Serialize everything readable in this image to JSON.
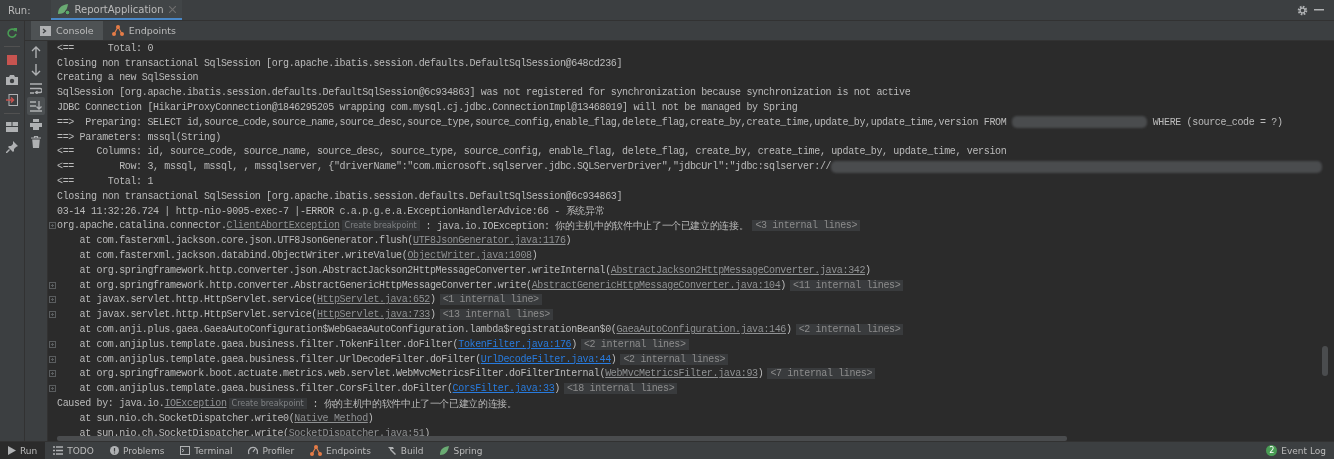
{
  "run_bar": {
    "label": "Run:",
    "tabs": [
      {
        "label": "ReportApplication",
        "selected": true
      }
    ]
  },
  "console_tabs": [
    {
      "label": "Console",
      "kind": "console",
      "selected": true
    },
    {
      "label": "Endpoints",
      "kind": "endpoints",
      "selected": false
    }
  ],
  "left_tools": [
    {
      "kind": "rerun",
      "on": false
    },
    {
      "kind": "stop",
      "on": false
    },
    {
      "kind": "camera",
      "on": false
    },
    {
      "kind": "exit",
      "on": false
    },
    {
      "kind": "layout",
      "on": false
    },
    {
      "kind": "pin",
      "on": false
    }
  ],
  "console_tools": [
    {
      "kind": "up",
      "on": false
    },
    {
      "kind": "down",
      "on": false
    },
    {
      "kind": "wrap",
      "on": false
    },
    {
      "kind": "scroll-end",
      "on": true
    },
    {
      "kind": "print",
      "on": false
    },
    {
      "kind": "trash",
      "on": false
    }
  ],
  "console_lines": [
    {
      "fold": false,
      "segments": [
        {
          "kind": "text",
          "text": "<==      Total: 0"
        }
      ]
    },
    {
      "fold": false,
      "segments": [
        {
          "kind": "text",
          "text": "Closing non transactional SqlSession [org.apache.ibatis.session.defaults.DefaultSqlSession@648cd236]"
        }
      ]
    },
    {
      "fold": false,
      "segments": [
        {
          "kind": "text",
          "text": "Creating a new SqlSession"
        }
      ]
    },
    {
      "fold": false,
      "segments": [
        {
          "kind": "text",
          "text": "SqlSession [org.apache.ibatis.session.defaults.DefaultSqlSession@6c934863] was not registered for synchronization because synchronization is not active"
        }
      ]
    },
    {
      "fold": false,
      "segments": [
        {
          "kind": "text",
          "text": "JDBC Connection [HikariProxyConnection@1846295205 wrapping com.mysql.cj.jdbc.ConnectionImpl@13468019] will not be managed by Spring"
        }
      ]
    },
    {
      "fold": false,
      "segments": [
        {
          "kind": "text",
          "text": "==>  Preparing: SELECT id,source_code,source_name,source_desc,source_type,source_config,enable_flag,delete_flag,create_by,create_time,update_by,update_time,version FROM "
        },
        {
          "kind": "redacted"
        },
        {
          "kind": "text",
          "text": " WHERE (source_code = ?)"
        }
      ]
    },
    {
      "fold": false,
      "segments": [
        {
          "kind": "text",
          "text": "==> Parameters: mssql(String)"
        }
      ]
    },
    {
      "fold": false,
      "segments": [
        {
          "kind": "text",
          "text": "<==    Columns: id, source_code, source_name, source_desc, source_type, source_config, enable_flag, delete_flag, create_by, create_time, update_by, update_time, version"
        }
      ]
    },
    {
      "fold": false,
      "segments": [
        {
          "kind": "text",
          "text": "<==        Row: 3, mssql, mssql, , mssqlserver, {\"driverName\":\"com.microsoft.sqlserver.jdbc.SQLServerDriver\",\"jdbcUrl\":\"jdbc:sqlserver://"
        },
        {
          "kind": "redacted"
        }
      ]
    },
    {
      "fold": false,
      "segments": [
        {
          "kind": "text",
          "text": "<==      Total: 1"
        }
      ]
    },
    {
      "fold": false,
      "segments": [
        {
          "kind": "text",
          "text": "Closing non transactional SqlSession [org.apache.ibatis.session.defaults.DefaultSqlSession@6c934863]"
        }
      ]
    },
    {
      "fold": false,
      "segments": [
        {
          "kind": "text",
          "text": "03-14 11:32:26.724 | http-nio-9095-exec-7 |-ERROR c.a.p.g.e.a.ExceptionHandlerAdvice:66 - 系统异常"
        }
      ]
    },
    {
      "fold": true,
      "segments": [
        {
          "kind": "text",
          "text": "org.apache.catalina.connector."
        },
        {
          "kind": "link",
          "text": "ClientAbortException"
        },
        {
          "kind": "breakpoint",
          "text": "Create breakpoint"
        },
        {
          "kind": "text",
          "text": " : java.io.IOException: 你的主机中的软件中止了一个已建立的连接。"
        },
        {
          "kind": "hint",
          "text": "<3 internal lines>"
        }
      ]
    },
    {
      "fold": false,
      "segments": [
        {
          "kind": "text",
          "text": "    at com.fasterxml.jackson.core.json.UTF8JsonGenerator.flush("
        },
        {
          "kind": "link",
          "text": "UTF8JsonGenerator.java:1176"
        },
        {
          "kind": "text",
          "text": ")"
        }
      ]
    },
    {
      "fold": false,
      "segments": [
        {
          "kind": "text",
          "text": "    at com.fasterxml.jackson.databind.ObjectWriter.writeValue("
        },
        {
          "kind": "link",
          "text": "ObjectWriter.java:1008"
        },
        {
          "kind": "text",
          "text": ")"
        }
      ]
    },
    {
      "fold": false,
      "segments": [
        {
          "kind": "text",
          "text": "    at org.springframework.http.converter.json.AbstractJackson2HttpMessageConverter.writeInternal("
        },
        {
          "kind": "link",
          "text": "AbstractJackson2HttpMessageConverter.java:342"
        },
        {
          "kind": "text",
          "text": ")"
        }
      ]
    },
    {
      "fold": true,
      "segments": [
        {
          "kind": "text",
          "text": "    at org.springframework.http.converter.AbstractGenericHttpMessageConverter.write("
        },
        {
          "kind": "link",
          "text": "AbstractGenericHttpMessageConverter.java:104"
        },
        {
          "kind": "text",
          "text": ")"
        },
        {
          "kind": "hint",
          "text": "<11 internal lines>"
        }
      ]
    },
    {
      "fold": true,
      "segments": [
        {
          "kind": "text",
          "text": "    at javax.servlet.http.HttpServlet.service("
        },
        {
          "kind": "link",
          "text": "HttpServlet.java:652"
        },
        {
          "kind": "text",
          "text": ")"
        },
        {
          "kind": "hint",
          "text": "<1 internal line>"
        }
      ]
    },
    {
      "fold": true,
      "segments": [
        {
          "kind": "text",
          "text": "    at javax.servlet.http.HttpServlet.service("
        },
        {
          "kind": "link",
          "text": "HttpServlet.java:733"
        },
        {
          "kind": "text",
          "text": ")"
        },
        {
          "kind": "hint",
          "text": "<13 internal lines>"
        }
      ]
    },
    {
      "fold": false,
      "segments": [
        {
          "kind": "text",
          "text": "    at com.anji.plus.gaea.GaeaAutoConfiguration$WebGaeaAutoConfiguration.lambda$registrationBean$0("
        },
        {
          "kind": "link",
          "text": "GaeaAutoConfiguration.java:146"
        },
        {
          "kind": "text",
          "text": ")"
        },
        {
          "kind": "hint",
          "text": "<2 internal lines>"
        }
      ]
    },
    {
      "fold": true,
      "segments": [
        {
          "kind": "text",
          "text": "    at com.anjiplus.template.gaea.business.filter.TokenFilter.doFilter("
        },
        {
          "kind": "source-link",
          "text": "TokenFilter.java:176"
        },
        {
          "kind": "text",
          "text": ")"
        },
        {
          "kind": "hint",
          "text": "<2 internal lines>"
        }
      ]
    },
    {
      "fold": true,
      "segments": [
        {
          "kind": "text",
          "text": "    at com.anjiplus.template.gaea.business.filter.UrlDecodeFilter.doFilter("
        },
        {
          "kind": "source-link",
          "text": "UrlDecodeFilter.java:44"
        },
        {
          "kind": "text",
          "text": ")"
        },
        {
          "kind": "hint",
          "text": "<2 internal lines>"
        }
      ]
    },
    {
      "fold": true,
      "segments": [
        {
          "kind": "text",
          "text": "    at org.springframework.boot.actuate.metrics.web.servlet.WebMvcMetricsFilter.doFilterInternal("
        },
        {
          "kind": "link",
          "text": "WebMvcMetricsFilter.java:93"
        },
        {
          "kind": "text",
          "text": ")"
        },
        {
          "kind": "hint",
          "text": "<7 internal lines>"
        }
      ]
    },
    {
      "fold": true,
      "segments": [
        {
          "kind": "text",
          "text": "    at com.anjiplus.template.gaea.business.filter.CorsFilter.doFilter("
        },
        {
          "kind": "source-link",
          "text": "CorsFilter.java:33"
        },
        {
          "kind": "text",
          "text": ")"
        },
        {
          "kind": "hint",
          "text": "<18 internal lines>"
        }
      ]
    },
    {
      "fold": false,
      "segments": [
        {
          "kind": "text",
          "text": "Caused by: java.io."
        },
        {
          "kind": "link",
          "text": "IOException"
        },
        {
          "kind": "breakpoint",
          "text": "Create breakpoint"
        },
        {
          "kind": "text",
          "text": " : 你的主机中的软件中止了一个已建立的连接。"
        }
      ]
    },
    {
      "fold": false,
      "segments": [
        {
          "kind": "text",
          "text": "    at sun.nio.ch.SocketDispatcher.write0("
        },
        {
          "kind": "link",
          "text": "Native Method"
        },
        {
          "kind": "text",
          "text": ")"
        }
      ]
    },
    {
      "fold": false,
      "segments": [
        {
          "kind": "text",
          "text": "    at sun.nio.ch.SocketDispatcher.write("
        },
        {
          "kind": "link",
          "text": "SocketDispatcher.java:51"
        },
        {
          "kind": "text",
          "text": ")"
        }
      ]
    }
  ],
  "bottom_tools": [
    {
      "label": "Run",
      "kind": "run",
      "selected": true
    },
    {
      "label": "TODO",
      "kind": "todo",
      "selected": false
    },
    {
      "label": "Problems",
      "kind": "problems",
      "selected": false
    },
    {
      "label": "Terminal",
      "kind": "terminal",
      "selected": false
    },
    {
      "label": "Profiler",
      "kind": "profiler",
      "selected": false
    },
    {
      "label": "Endpoints",
      "kind": "endpoints",
      "selected": false
    },
    {
      "label": "Build",
      "kind": "build",
      "selected": false
    },
    {
      "label": "Spring",
      "kind": "spring",
      "selected": false
    }
  ],
  "event_log": {
    "label": "Event Log",
    "badge": "2"
  }
}
